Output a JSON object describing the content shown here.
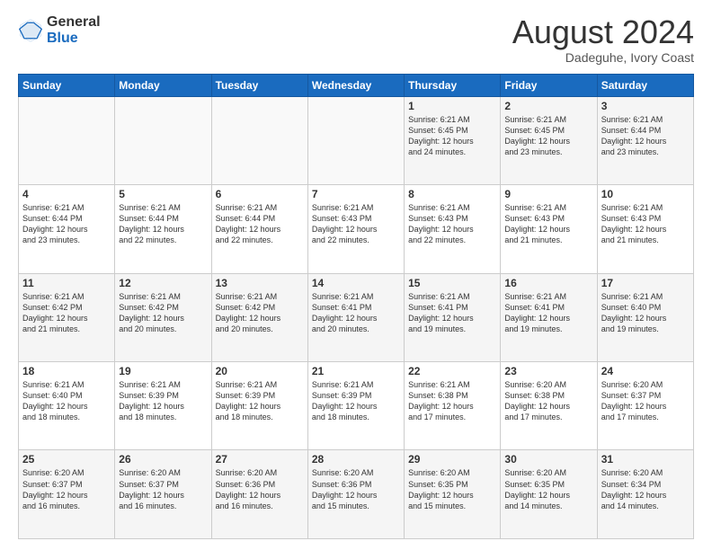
{
  "logo": {
    "line1": "General",
    "line2": "Blue"
  },
  "title": "August 2024",
  "subtitle": "Dadeguhe, Ivory Coast",
  "days_header": [
    "Sunday",
    "Monday",
    "Tuesday",
    "Wednesday",
    "Thursday",
    "Friday",
    "Saturday"
  ],
  "weeks": [
    [
      {
        "day": "",
        "info": ""
      },
      {
        "day": "",
        "info": ""
      },
      {
        "day": "",
        "info": ""
      },
      {
        "day": "",
        "info": ""
      },
      {
        "day": "1",
        "info": "Sunrise: 6:21 AM\nSunset: 6:45 PM\nDaylight: 12 hours\nand 24 minutes."
      },
      {
        "day": "2",
        "info": "Sunrise: 6:21 AM\nSunset: 6:45 PM\nDaylight: 12 hours\nand 23 minutes."
      },
      {
        "day": "3",
        "info": "Sunrise: 6:21 AM\nSunset: 6:44 PM\nDaylight: 12 hours\nand 23 minutes."
      }
    ],
    [
      {
        "day": "4",
        "info": "Sunrise: 6:21 AM\nSunset: 6:44 PM\nDaylight: 12 hours\nand 23 minutes."
      },
      {
        "day": "5",
        "info": "Sunrise: 6:21 AM\nSunset: 6:44 PM\nDaylight: 12 hours\nand 22 minutes."
      },
      {
        "day": "6",
        "info": "Sunrise: 6:21 AM\nSunset: 6:44 PM\nDaylight: 12 hours\nand 22 minutes."
      },
      {
        "day": "7",
        "info": "Sunrise: 6:21 AM\nSunset: 6:43 PM\nDaylight: 12 hours\nand 22 minutes."
      },
      {
        "day": "8",
        "info": "Sunrise: 6:21 AM\nSunset: 6:43 PM\nDaylight: 12 hours\nand 22 minutes."
      },
      {
        "day": "9",
        "info": "Sunrise: 6:21 AM\nSunset: 6:43 PM\nDaylight: 12 hours\nand 21 minutes."
      },
      {
        "day": "10",
        "info": "Sunrise: 6:21 AM\nSunset: 6:43 PM\nDaylight: 12 hours\nand 21 minutes."
      }
    ],
    [
      {
        "day": "11",
        "info": "Sunrise: 6:21 AM\nSunset: 6:42 PM\nDaylight: 12 hours\nand 21 minutes."
      },
      {
        "day": "12",
        "info": "Sunrise: 6:21 AM\nSunset: 6:42 PM\nDaylight: 12 hours\nand 20 minutes."
      },
      {
        "day": "13",
        "info": "Sunrise: 6:21 AM\nSunset: 6:42 PM\nDaylight: 12 hours\nand 20 minutes."
      },
      {
        "day": "14",
        "info": "Sunrise: 6:21 AM\nSunset: 6:41 PM\nDaylight: 12 hours\nand 20 minutes."
      },
      {
        "day": "15",
        "info": "Sunrise: 6:21 AM\nSunset: 6:41 PM\nDaylight: 12 hours\nand 19 minutes."
      },
      {
        "day": "16",
        "info": "Sunrise: 6:21 AM\nSunset: 6:41 PM\nDaylight: 12 hours\nand 19 minutes."
      },
      {
        "day": "17",
        "info": "Sunrise: 6:21 AM\nSunset: 6:40 PM\nDaylight: 12 hours\nand 19 minutes."
      }
    ],
    [
      {
        "day": "18",
        "info": "Sunrise: 6:21 AM\nSunset: 6:40 PM\nDaylight: 12 hours\nand 18 minutes."
      },
      {
        "day": "19",
        "info": "Sunrise: 6:21 AM\nSunset: 6:39 PM\nDaylight: 12 hours\nand 18 minutes."
      },
      {
        "day": "20",
        "info": "Sunrise: 6:21 AM\nSunset: 6:39 PM\nDaylight: 12 hours\nand 18 minutes."
      },
      {
        "day": "21",
        "info": "Sunrise: 6:21 AM\nSunset: 6:39 PM\nDaylight: 12 hours\nand 18 minutes."
      },
      {
        "day": "22",
        "info": "Sunrise: 6:21 AM\nSunset: 6:38 PM\nDaylight: 12 hours\nand 17 minutes."
      },
      {
        "day": "23",
        "info": "Sunrise: 6:20 AM\nSunset: 6:38 PM\nDaylight: 12 hours\nand 17 minutes."
      },
      {
        "day": "24",
        "info": "Sunrise: 6:20 AM\nSunset: 6:37 PM\nDaylight: 12 hours\nand 17 minutes."
      }
    ],
    [
      {
        "day": "25",
        "info": "Sunrise: 6:20 AM\nSunset: 6:37 PM\nDaylight: 12 hours\nand 16 minutes."
      },
      {
        "day": "26",
        "info": "Sunrise: 6:20 AM\nSunset: 6:37 PM\nDaylight: 12 hours\nand 16 minutes."
      },
      {
        "day": "27",
        "info": "Sunrise: 6:20 AM\nSunset: 6:36 PM\nDaylight: 12 hours\nand 16 minutes."
      },
      {
        "day": "28",
        "info": "Sunrise: 6:20 AM\nSunset: 6:36 PM\nDaylight: 12 hours\nand 15 minutes."
      },
      {
        "day": "29",
        "info": "Sunrise: 6:20 AM\nSunset: 6:35 PM\nDaylight: 12 hours\nand 15 minutes."
      },
      {
        "day": "30",
        "info": "Sunrise: 6:20 AM\nSunset: 6:35 PM\nDaylight: 12 hours\nand 14 minutes."
      },
      {
        "day": "31",
        "info": "Sunrise: 6:20 AM\nSunset: 6:34 PM\nDaylight: 12 hours\nand 14 minutes."
      }
    ]
  ]
}
